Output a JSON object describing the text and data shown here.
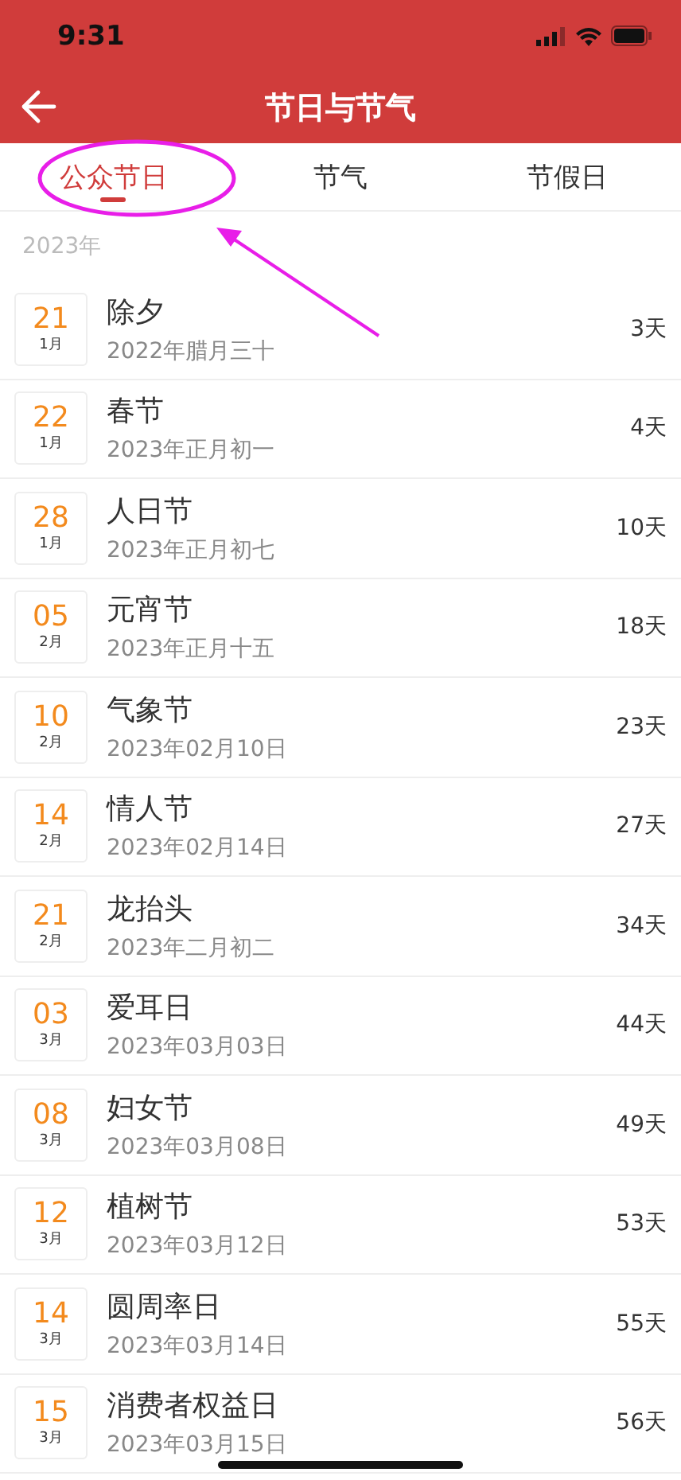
{
  "status_bar": {
    "time": "9:31"
  },
  "nav_bar": {
    "title": "节日与节气"
  },
  "tabs": [
    {
      "label": "公众节日",
      "selected": true
    },
    {
      "label": "节气",
      "selected": false
    },
    {
      "label": "节假日",
      "selected": false
    }
  ],
  "section": {
    "title": "2023年"
  },
  "holidays": [
    {
      "day": "21",
      "month": "1月",
      "name": "除夕",
      "date": "2022年腊月三十",
      "days_left": "3天"
    },
    {
      "day": "22",
      "month": "1月",
      "name": "春节",
      "date": "2023年正月初一",
      "days_left": "4天"
    },
    {
      "day": "28",
      "month": "1月",
      "name": "人日节",
      "date": "2023年正月初七",
      "days_left": "10天"
    },
    {
      "day": "05",
      "month": "2月",
      "name": "元宵节",
      "date": "2023年正月十五",
      "days_left": "18天"
    },
    {
      "day": "10",
      "month": "2月",
      "name": "气象节",
      "date": "2023年02月10日",
      "days_left": "23天"
    },
    {
      "day": "14",
      "month": "2月",
      "name": "情人节",
      "date": "2023年02月14日",
      "days_left": "27天"
    },
    {
      "day": "21",
      "month": "2月",
      "name": "龙抬头",
      "date": "2023年二月初二",
      "days_left": "34天"
    },
    {
      "day": "03",
      "month": "3月",
      "name": "爱耳日",
      "date": "2023年03月03日",
      "days_left": "44天"
    },
    {
      "day": "08",
      "month": "3月",
      "name": "妇女节",
      "date": "2023年03月08日",
      "days_left": "49天"
    },
    {
      "day": "12",
      "month": "3月",
      "name": "植树节",
      "date": "2023年03月12日",
      "days_left": "53天"
    },
    {
      "day": "14",
      "month": "3月",
      "name": "圆周率日",
      "date": "2023年03月14日",
      "days_left": "55天"
    },
    {
      "day": "15",
      "month": "3月",
      "name": "消费者权益日",
      "date": "2023年03月15日",
      "days_left": "56天"
    }
  ]
}
